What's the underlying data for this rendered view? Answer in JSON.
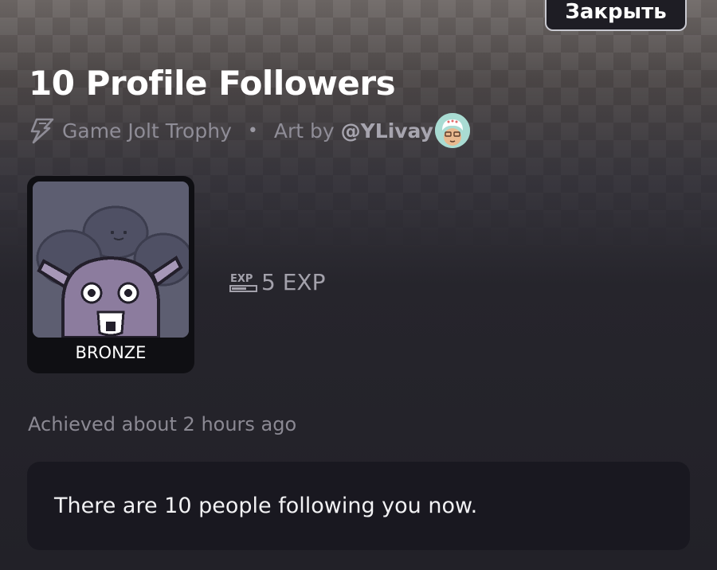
{
  "header": {
    "close_label": "Закрыть"
  },
  "trophy": {
    "title": "10 Profile Followers",
    "type_label": "Game Jolt Trophy",
    "separator": "•",
    "art_by_label": "Art by",
    "artist": "@YLivay",
    "tier": "BRONZE",
    "exp_value": "5 EXP",
    "achieved": "Achieved about 2 hours ago",
    "description": "There are 10 people following you now."
  },
  "icons": {
    "trophy_type": "lightning-trophy-icon",
    "exp": "exp-icon"
  },
  "colors": {
    "background": "#222128",
    "card": "#191820",
    "tier_frame": "#0f0f13"
  }
}
